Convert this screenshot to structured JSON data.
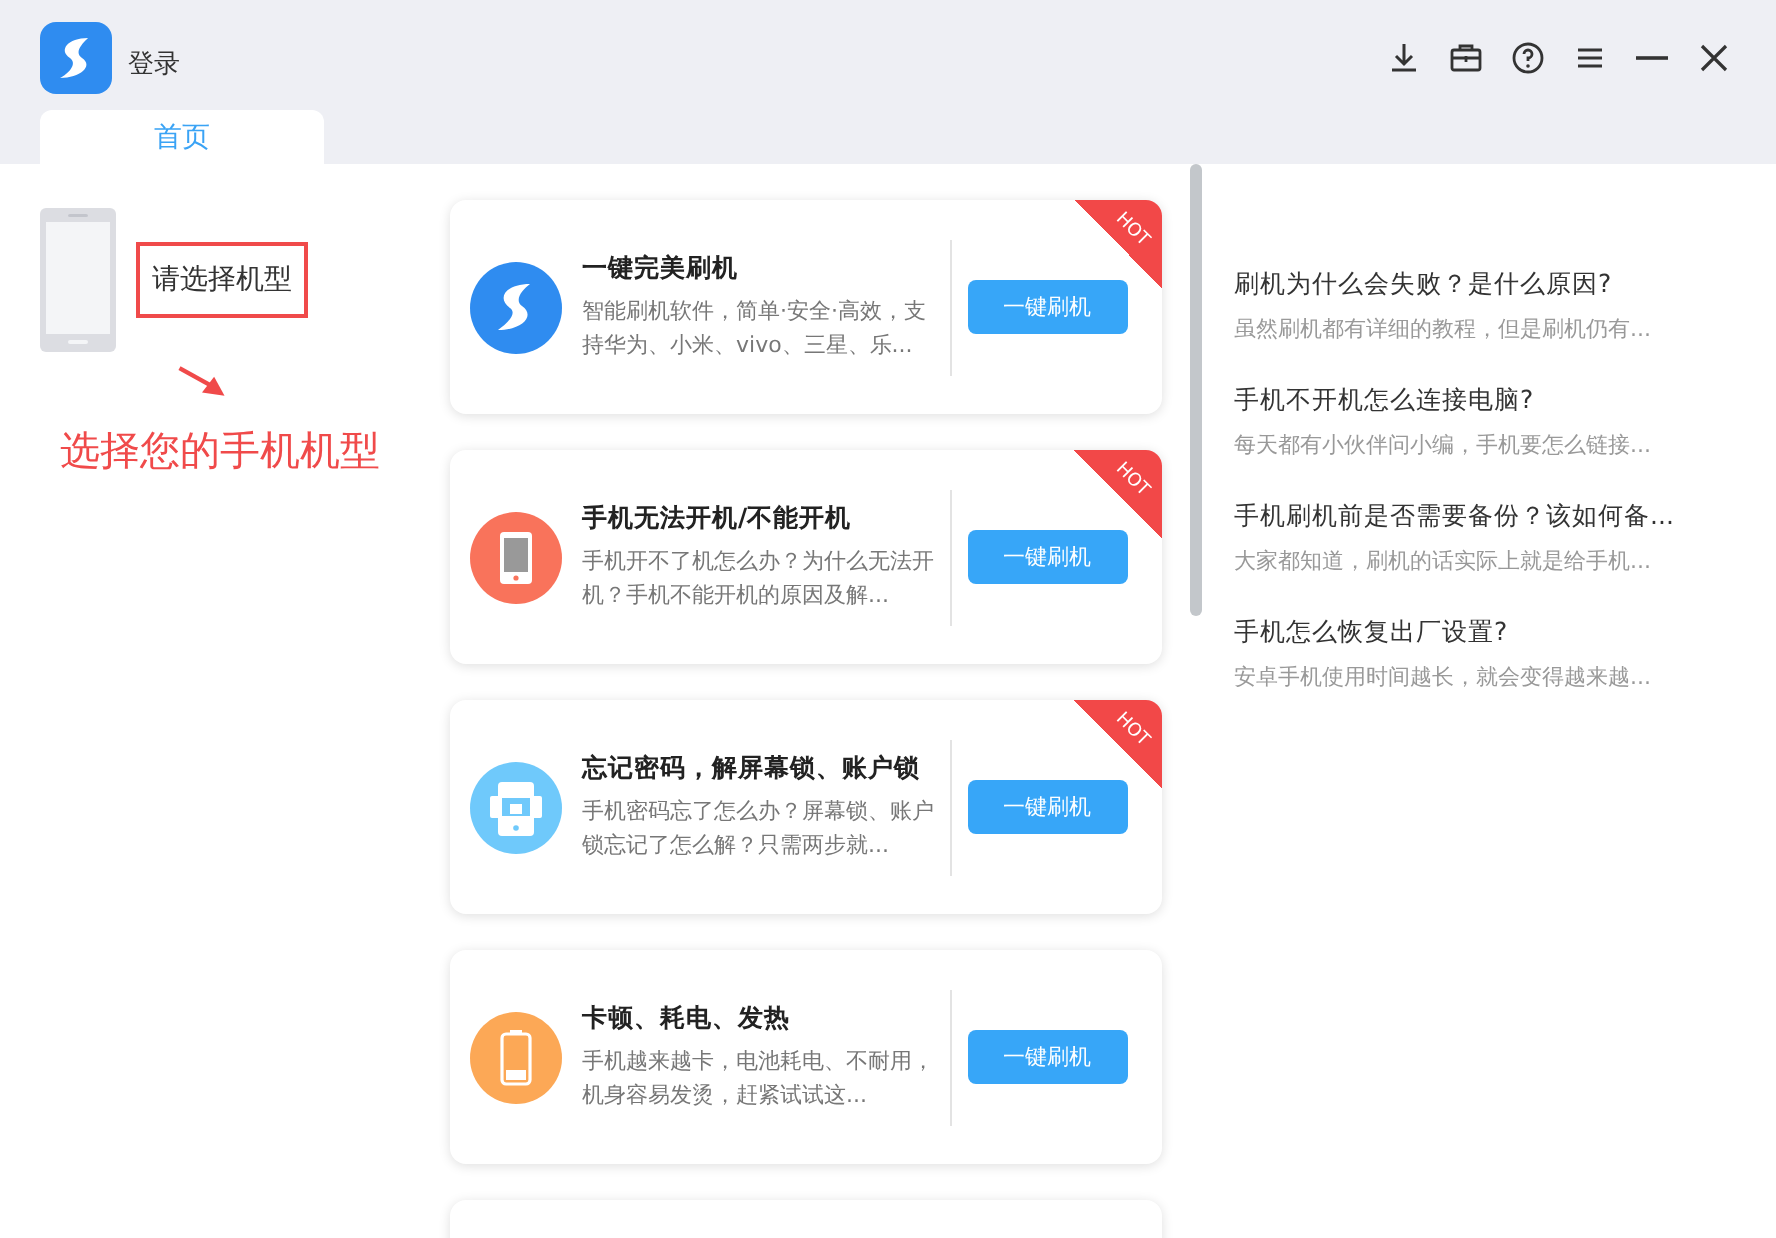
{
  "window": {
    "title": "登录"
  },
  "tabs": [
    {
      "label": "首页",
      "selected": true
    }
  ],
  "device": {
    "prompt": "请选择机型"
  },
  "annotation": {
    "text": "选择您的手机机型"
  },
  "cards": [
    {
      "kind": "logo",
      "title": "一键完美刷机",
      "description": "智能刷机软件，简单·安全·高效，支持华为、小米、vivo、三星、乐...",
      "button": "一键刷机",
      "hot": "HOT"
    },
    {
      "kind": "phone",
      "title": "手机无法开机/不能开机",
      "description": "手机开不了机怎么办？为什么无法开机？手机不能开机的原因及解...",
      "button": "一键刷机",
      "hot": "HOT"
    },
    {
      "kind": "lock",
      "title": "忘记密码，解屏幕锁、账户锁",
      "description": "手机密码忘了怎么办？屏幕锁、账户锁忘记了怎么解？只需两步就...",
      "button": "一键刷机",
      "hot": "HOT"
    },
    {
      "kind": "battery",
      "title": "卡顿、耗电、发热",
      "description": "手机越来越卡，电池耗电、不耐用，机身容易发烫，赶紧试试这...",
      "button": "一键刷机"
    }
  ],
  "articles": [
    {
      "title": "刷机为什么会失败？是什么原因?",
      "summary": "虽然刷机都有详细的教程，但是刷机仍有..."
    },
    {
      "title": "手机不开机怎么连接电脑?",
      "summary": "每天都有小伙伴问小编，手机要怎么链接..."
    },
    {
      "title": "手机刷机前是否需要备份？该如何备...",
      "summary": "大家都知道，刷机的话实际上就是给手机..."
    },
    {
      "title": "手机怎么恢复出厂设置?",
      "summary": "安卓手机使用时间越长，就会变得越来越..."
    }
  ]
}
